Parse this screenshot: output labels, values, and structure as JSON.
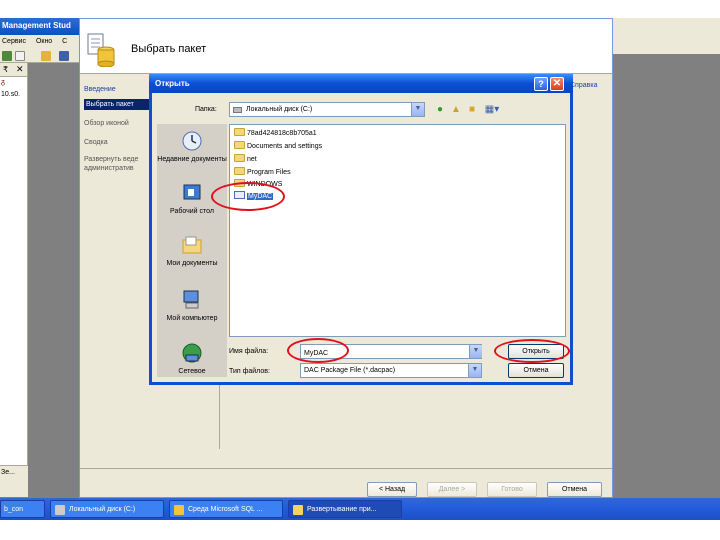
{
  "background_app": {
    "title": "Management Stud",
    "menu": [
      "Сервис",
      "Окно",
      "С"
    ],
    "explorer_pin": "₹",
    "explorer_close": "✕",
    "server_node": "ᵹ",
    "server_name": "10.s0.",
    "explorer_footer": "Зе..."
  },
  "wizard": {
    "title": "Выбрать пакет",
    "steps": [
      {
        "label": "Введение",
        "state": "link"
      },
      {
        "label": "Выбрать пакет",
        "state": "active"
      },
      {
        "label": "Обзор иконой",
        "state": "normal"
      },
      {
        "label": "Сводка",
        "state": "normal"
      },
      {
        "label": "Развернуть веде административ",
        "state": "normal"
      }
    ],
    "right_link": "Справка",
    "buttons": {
      "back": "< Назад",
      "next": "Далее >",
      "finish": "Готово",
      "cancel": "Отмена"
    }
  },
  "dialog": {
    "title": "Открыть",
    "help_glyph": "?",
    "close_glyph": "✕",
    "look_in_label": "Папка:",
    "look_in_value": "Локальный диск (C:)",
    "places": [
      {
        "label": "Недавние документы",
        "icon": "recent-documents-icon"
      },
      {
        "label": "Рабочий стол",
        "icon": "desktop-icon"
      },
      {
        "label": "Мои документы",
        "icon": "my-documents-icon"
      },
      {
        "label": "Мой компьютер",
        "icon": "my-computer-icon"
      },
      {
        "label": "Сетевое",
        "icon": "network-icon"
      }
    ],
    "files": [
      {
        "name": "78ad424818c8b705a1",
        "type": "folder"
      },
      {
        "name": "Documents and settings",
        "type": "folder"
      },
      {
        "name": "net",
        "type": "folder"
      },
      {
        "name": "Program Files",
        "type": "folder"
      },
      {
        "name": "WINDOWS",
        "type": "folder"
      },
      {
        "name": "MyDAC",
        "type": "package",
        "selected": true
      }
    ],
    "file_name_label": "Имя файла:",
    "file_name_value": "MyDAC",
    "file_type_label": "Тип файлов:",
    "file_type_value": "DAC Package File (*.dacpac)",
    "open_button": "Открыть",
    "cancel_button": "Отмена"
  },
  "taskbar": {
    "items": [
      {
        "label": "b_con",
        "active": false
      },
      {
        "label": "Локальный диск (C:)",
        "active": false
      },
      {
        "label": "Среда Microsoft SQL ...",
        "active": false
      },
      {
        "label": "Развертывание при...",
        "active": true
      }
    ]
  },
  "colors": {
    "annotation": "#e0101e",
    "xp_blue": "#0b4fd3",
    "selection": "#316ac5"
  }
}
